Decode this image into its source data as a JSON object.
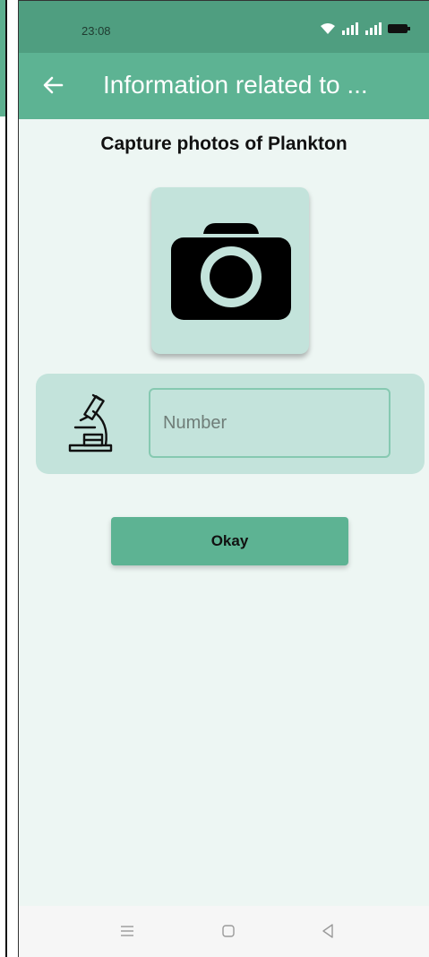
{
  "status_bar": {
    "time": "23:08",
    "icons": [
      "wifi-icon",
      "signal-icon",
      "signal-icon",
      "battery-icon"
    ]
  },
  "app_bar": {
    "back_icon": "arrow-left-icon",
    "title": "Information related to ..."
  },
  "main": {
    "heading": "Capture photos of Plankton",
    "camera_icon": "camera-icon",
    "microscope_icon": "microscope-icon",
    "number_field": {
      "placeholder": "Number",
      "value": ""
    },
    "okay_label": "Okay"
  },
  "nav_bar": {
    "items": [
      "menu-icon",
      "home-icon",
      "back-icon"
    ]
  },
  "colors": {
    "status_bar": "#4f9e80",
    "app_bar": "#5db393",
    "background": "#edf6f3",
    "card": "#c3e3db",
    "button": "#5db393"
  }
}
